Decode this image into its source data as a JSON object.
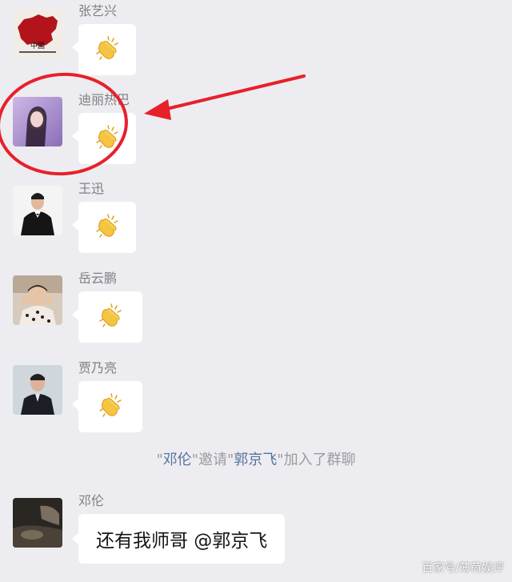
{
  "messages": [
    {
      "sender": "张艺兴",
      "content": "clap-emoji",
      "avatar": "china-map-avatar"
    },
    {
      "sender": "迪丽热巴",
      "content": "clap-emoji",
      "avatar": "woman-portrait-avatar"
    },
    {
      "sender": "王迅",
      "content": "clap-emoji",
      "avatar": "man-suit-avatar"
    },
    {
      "sender": "岳云鹏",
      "content": "clap-emoji",
      "avatar": "child-photo-avatar"
    },
    {
      "sender": "贾乃亮",
      "content": "clap-emoji",
      "avatar": "man-portrait-avatar"
    }
  ],
  "system_notice": {
    "q1": "\"",
    "inviter": "邓伦",
    "q2": "\"",
    "verb": "邀请",
    "q3": "\"",
    "invitee": "郭京飞",
    "q4": "\"",
    "suffix": "加入了群聊"
  },
  "last_message": {
    "sender": "邓伦",
    "text": "还有我师哥 @郭京飞"
  },
  "watermark": "百家号/薄荷娱评",
  "colors": {
    "background": "#ededf1",
    "bubble": "#ffffff",
    "annotation": "#e8202a",
    "system_highlight": "#58739f"
  }
}
